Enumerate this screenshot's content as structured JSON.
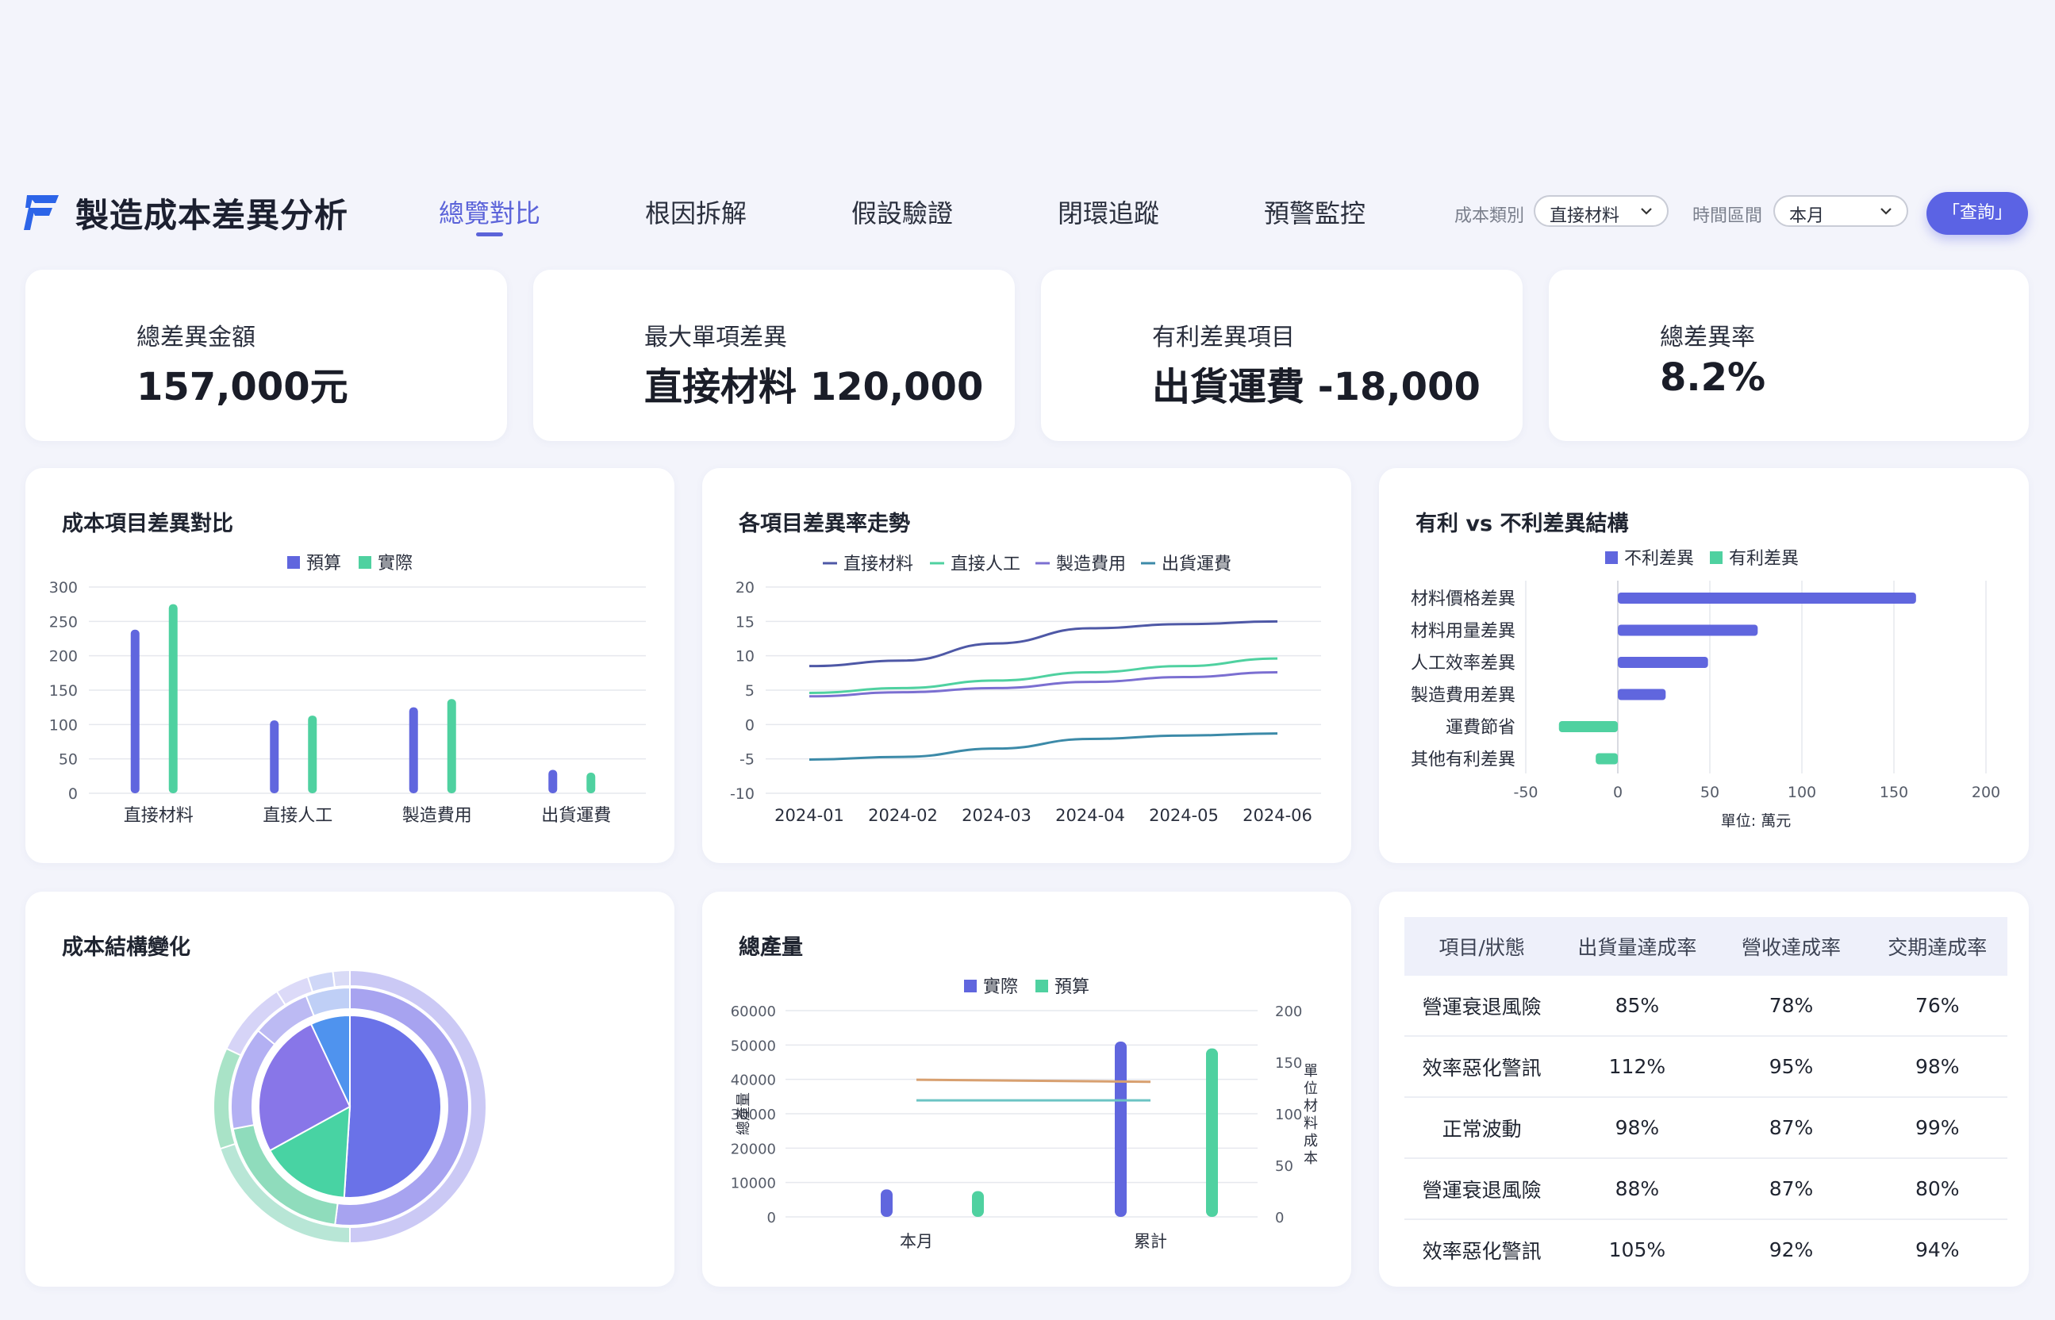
{
  "app": {
    "title": "製造成本差異分析"
  },
  "nav": {
    "tabs": [
      {
        "label": "總覽對比",
        "active": true
      },
      {
        "label": "根因拆解"
      },
      {
        "label": "假設驗證"
      },
      {
        "label": "閉環追蹤"
      },
      {
        "label": "預警監控"
      }
    ]
  },
  "filters": {
    "cost_category_label": "成本類別",
    "cost_category_value": "直接材料",
    "period_label": "時間區間",
    "period_value": "本月",
    "query_label": "「查詢」"
  },
  "kpis": [
    {
      "label": "總差異金額",
      "value": "157,000元"
    },
    {
      "label": "最大單項差異",
      "value": "直接材料 120,000"
    },
    {
      "label": "有利差異項目",
      "value": "出貨運費 -18,000"
    },
    {
      "label": "總差異率",
      "value": "8.2%"
    }
  ],
  "colors": {
    "accent": "#5b63e4",
    "purple": "#6066de",
    "green": "#4fd1a0",
    "teal": "#3c8aa8"
  },
  "chart_data": [
    {
      "type": "bar",
      "title": "成本項目差異對比",
      "categories": [
        "直接材料",
        "直接人工",
        "製造費用",
        "出貨運費"
      ],
      "series": [
        {
          "name": "預算",
          "values": [
            238,
            106,
            125,
            34
          ],
          "color": "#6066de"
        },
        {
          "name": "實際",
          "values": [
            275,
            113,
            137,
            30
          ],
          "color": "#4fd1a0"
        }
      ],
      "ylim": [
        0,
        300
      ],
      "yticks": [
        0,
        50,
        100,
        150,
        200,
        250,
        300
      ],
      "legend": "top"
    },
    {
      "type": "line",
      "title": "各項目差異率走勢",
      "x": [
        "2024-01",
        "2024-02",
        "2024-03",
        "2024-04",
        "2024-05",
        "2024-06"
      ],
      "series": [
        {
          "name": "直接材料",
          "values": [
            8.5,
            9.3,
            11.8,
            14,
            14.6,
            15
          ],
          "color": "#4e58a6"
        },
        {
          "name": "直接人工",
          "values": [
            4.6,
            5.3,
            6.4,
            7.6,
            8.5,
            9.6
          ],
          "color": "#4fd1a0"
        },
        {
          "name": "製造費用",
          "values": [
            4.1,
            4.7,
            5.3,
            6.2,
            6.9,
            7.6
          ],
          "color": "#7b6fd1"
        },
        {
          "name": "出貨運費",
          "values": [
            -5.1,
            -4.7,
            -3.5,
            -2.1,
            -1.6,
            -1.3
          ],
          "color": "#3c8aa8"
        }
      ],
      "ylim": [
        -10,
        20
      ],
      "yticks": [
        -10,
        -5,
        0,
        5,
        10,
        15,
        20
      ],
      "legend": "top"
    },
    {
      "type": "bar",
      "orientation": "horizontal",
      "title": "有利 vs 不利差異結構",
      "categories": [
        "材料價格差異",
        "材料用量差異",
        "人工效率差異",
        "製造費用差異",
        "運費節省",
        "其他有利差異"
      ],
      "values": [
        162,
        76,
        49,
        26,
        -32,
        -12
      ],
      "series_names": [
        "不利差異",
        "有利差異"
      ],
      "series_colors": [
        "#6066de",
        "#4fd1a0"
      ],
      "xlim": [
        -50,
        200
      ],
      "xticks": [
        -50,
        0,
        50,
        100,
        150,
        200
      ],
      "xlabel": "單位: 萬元",
      "legend": "top"
    },
    {
      "type": "pie",
      "title": "成本結構變化",
      "rings": [
        {
          "name": "outer",
          "values": [
            50,
            20,
            12,
            9,
            4,
            3,
            2
          ]
        },
        {
          "name": "middle",
          "values": [
            52,
            20,
            14,
            8,
            6
          ]
        },
        {
          "name": "inner",
          "values": [
            51,
            16,
            26,
            7
          ]
        }
      ]
    },
    {
      "type": "bar",
      "title": "總產量",
      "categories": [
        "本月",
        "累計"
      ],
      "series": [
        {
          "name": "實際",
          "values": [
            8000,
            51000
          ],
          "color": "#6066de"
        },
        {
          "name": "預算",
          "values": [
            7500,
            49000
          ],
          "color": "#4fd1a0"
        }
      ],
      "lines": [
        {
          "values": [
            133,
            131
          ],
          "color": "#d8a070",
          "axis": "right"
        },
        {
          "values": [
            113,
            113
          ],
          "color": "#6cc4c4",
          "axis": "right"
        }
      ],
      "ylim": [
        0,
        60000
      ],
      "yticks": [
        0,
        10000,
        20000,
        30000,
        40000,
        50000,
        60000
      ],
      "ylabel": "總產量",
      "y2lim": [
        0,
        200
      ],
      "y2ticks": [
        0,
        50,
        100,
        150,
        200
      ],
      "y2label": "單位材料成本",
      "legend": "top"
    }
  ],
  "table": {
    "headers": [
      "項目/狀態",
      "出貨量達成率",
      "營收達成率",
      "交期達成率"
    ],
    "rows": [
      [
        "營運衰退風險",
        "85%",
        "78%",
        "76%"
      ],
      [
        "效率惡化警訊",
        "112%",
        "95%",
        "98%"
      ],
      [
        "正常波動",
        "98%",
        "87%",
        "99%"
      ],
      [
        "營運衰退風險",
        "88%",
        "87%",
        "80%"
      ],
      [
        "效率惡化警訊",
        "105%",
        "92%",
        "94%"
      ]
    ]
  }
}
